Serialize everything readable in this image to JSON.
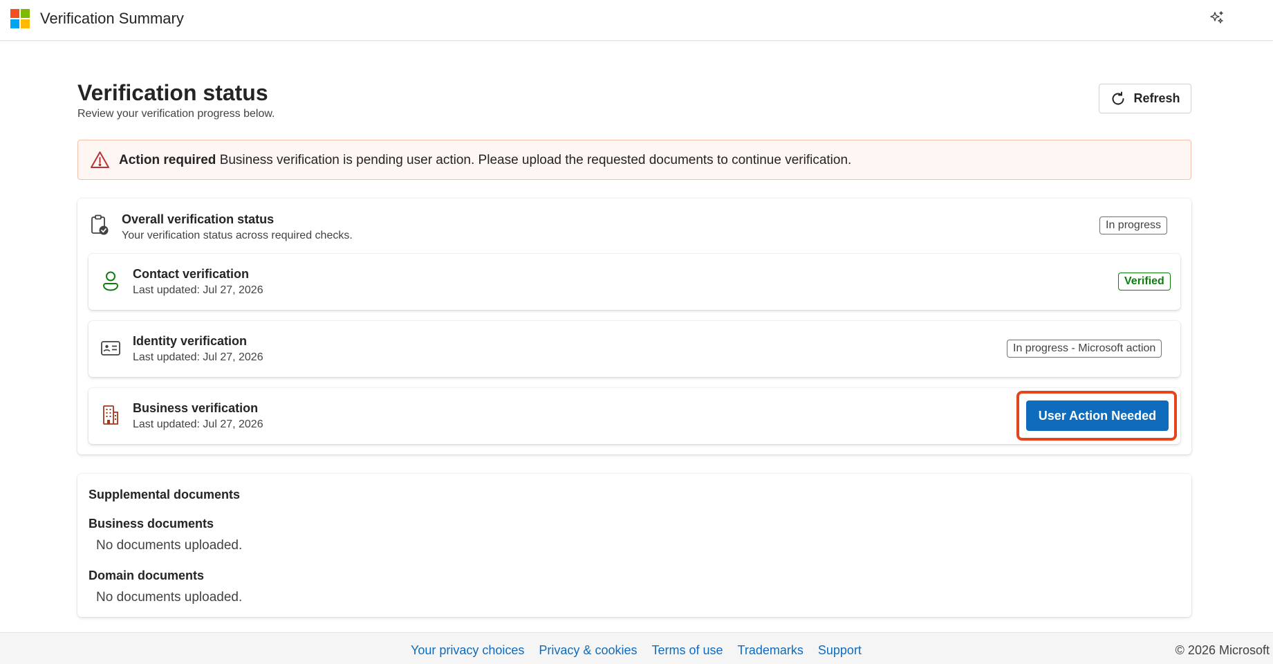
{
  "app": {
    "title": "Verification Summary",
    "brand_colors": [
      "#f25022",
      "#7fba00",
      "#00a4ef",
      "#ffb900"
    ]
  },
  "header": {
    "title": "Verification status",
    "subtitle": "Review your verification progress below.",
    "refresh_label": "Refresh"
  },
  "alert": {
    "title": "Action required",
    "message": "Business verification is pending user action. Please upload the requested documents to continue verification.",
    "icon": "warning-icon"
  },
  "overall": {
    "title": "Overall verification status",
    "subtitle": "Your verification status across required checks.",
    "status": "In progress",
    "icon": "clipboard-check-icon"
  },
  "checks": [
    {
      "title": "Contact verification",
      "updated": "Last updated: Jul 27, 2026",
      "status": "Verified",
      "icon": "person-icon"
    },
    {
      "title": "Identity verification",
      "updated": "Last updated: Jul 27, 2026",
      "status": "In progress - Microsoft action",
      "icon": "id-card-icon"
    },
    {
      "title": "Business verification",
      "updated": "Last updated: Jul 27, 2026",
      "action_label": "User Action Needed",
      "icon": "building-icon"
    }
  ],
  "documents": {
    "title": "Supplemental documents",
    "sections": [
      {
        "title": "Business documents",
        "empty": "No documents uploaded."
      },
      {
        "title": "Domain documents",
        "empty": "No documents uploaded."
      }
    ]
  },
  "footer": {
    "links": [
      "Your privacy choices",
      "Privacy & cookies",
      "Terms of use",
      "Trademarks",
      "Support"
    ],
    "copyright": "© 2026 Microsoft"
  },
  "colors": {
    "accent": "#0f6cbd",
    "success": "#107c10",
    "warning": "#bc2f32",
    "highlight": "#e4451f"
  }
}
